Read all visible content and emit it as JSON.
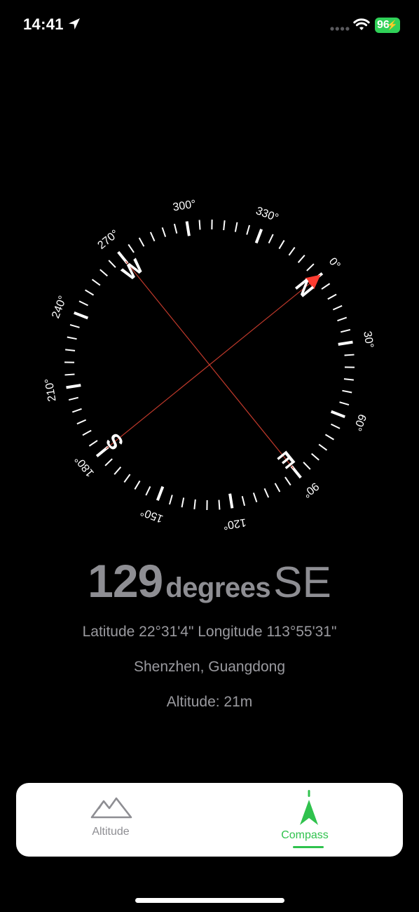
{
  "status_bar": {
    "time": "14:41",
    "battery": "96",
    "battery_color": "#30d158",
    "icons": [
      "location-arrow-icon",
      "cellular-signal-icon",
      "wifi-icon",
      "charging-bolt-icon"
    ]
  },
  "compass": {
    "heading_deg": 129,
    "rotation_note": "dial rotated so that the current heading points up",
    "cardinal_labels": [
      "N",
      "E",
      "S",
      "W"
    ],
    "degree_labels": [
      "0°",
      "30°",
      "60°",
      "90°",
      "120°",
      "150°",
      "180°",
      "210°",
      "240°",
      "270°",
      "300°",
      "330°"
    ],
    "north_arrow_color": "#ff3b30",
    "crosshair_color": "#c0392b"
  },
  "reading": {
    "value": "129",
    "unit": "degrees",
    "direction": "SE"
  },
  "location": {
    "coordinates": "Latitude 22°31'4\" Longitude 113°55'31\"",
    "city": "Shenzhen, Guangdong",
    "altitude": "Altitude: 21m"
  },
  "tab_bar": {
    "tabs": [
      {
        "label": "Altitude",
        "icon": "mountains-icon",
        "active": false
      },
      {
        "label": "Compass",
        "icon": "compass-needle-icon",
        "active": true
      }
    ],
    "active_color": "#2fc24d",
    "inactive_color": "#8e8e93"
  }
}
